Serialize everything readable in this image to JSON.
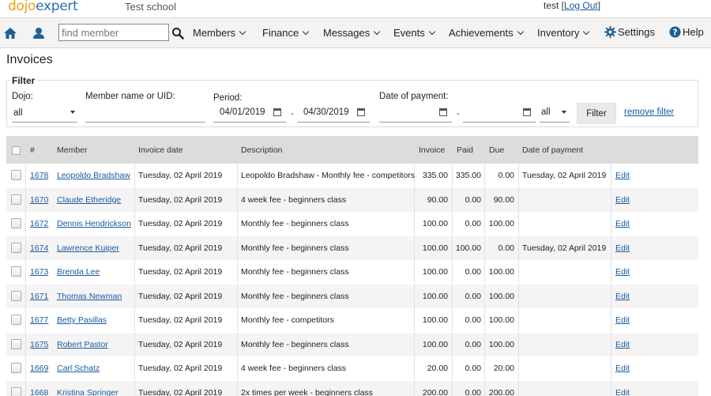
{
  "brand": {
    "logo_part1": "dojo",
    "logo_part2": "expert",
    "school": "Test school"
  },
  "user": {
    "name": "test",
    "logout_label": "Log Out"
  },
  "nav": {
    "search_placeholder": "find member",
    "items": [
      {
        "label": "Members"
      },
      {
        "label": "Finance"
      },
      {
        "label": "Messages"
      },
      {
        "label": "Events"
      },
      {
        "label": "Achievements"
      },
      {
        "label": "Inventory"
      },
      {
        "label": "Settings"
      },
      {
        "label": "Help"
      }
    ]
  },
  "page": {
    "title": "Invoices"
  },
  "filter": {
    "legend": "Filter",
    "dojo_label": "Dojo:",
    "dojo_value": "all",
    "member_label": "Member name or UID:",
    "member_value": "",
    "period_label": "Period:",
    "period_from": "04/01/2019",
    "period_to": "04/30/2019",
    "period_separator": "-",
    "payment_label": "Date of payment:",
    "payment_from": "",
    "payment_to": "",
    "payment_separator": "-",
    "payment_scope": "all",
    "filter_button": "Filter",
    "remove_filter": "remove filter"
  },
  "table": {
    "columns": [
      "#",
      "Member",
      "Invoice date",
      "Description",
      "Invoice",
      "Paid",
      "Due",
      "Date of payment"
    ],
    "rows": [
      {
        "id": "1678",
        "member": "Leopoldo Bradshaw",
        "date": "Tuesday, 02 April 2019",
        "description": "Leopoldo Bradshaw - Monthly fee - competitors",
        "invoice": "335.00",
        "paid": "335.00",
        "due": "0.00",
        "payment_date": "Tuesday, 02 April 2019",
        "action": "Edit"
      },
      {
        "id": "1670",
        "member": "Claude Etheridge",
        "date": "Tuesday, 02 April 2019",
        "description": "4 week fee - beginners class",
        "invoice": "90.00",
        "paid": "0.00",
        "due": "90.00",
        "payment_date": "",
        "action": "Edit"
      },
      {
        "id": "1672",
        "member": "Dennis Hendrickson",
        "date": "Tuesday, 02 April 2019",
        "description": "Monthly fee - beginners class",
        "invoice": "100.00",
        "paid": "0.00",
        "due": "100.00",
        "payment_date": "",
        "action": "Edit"
      },
      {
        "id": "1674",
        "member": "Lawrence Kuiper",
        "date": "Tuesday, 02 April 2019",
        "description": "Monthly fee - beginners class",
        "invoice": "100.00",
        "paid": "100.00",
        "due": "0.00",
        "payment_date": "Tuesday, 02 April 2019",
        "action": "Edit"
      },
      {
        "id": "1673",
        "member": "Brenda Lee",
        "date": "Tuesday, 02 April 2019",
        "description": "Monthly fee - beginners class",
        "invoice": "100.00",
        "paid": "0.00",
        "due": "100.00",
        "payment_date": "",
        "action": "Edit"
      },
      {
        "id": "1671",
        "member": "Thomas Newman",
        "date": "Tuesday, 02 April 2019",
        "description": "Monthly fee - beginners class",
        "invoice": "100.00",
        "paid": "0.00",
        "due": "100.00",
        "payment_date": "",
        "action": "Edit"
      },
      {
        "id": "1677",
        "member": "Betty Pasillas",
        "date": "Tuesday, 02 April 2019",
        "description": "Monthly fee - competitors",
        "invoice": "100.00",
        "paid": "0.00",
        "due": "100.00",
        "payment_date": "",
        "action": "Edit"
      },
      {
        "id": "1675",
        "member": "Robert Pastor",
        "date": "Tuesday, 02 April 2019",
        "description": "Monthly fee - beginners class",
        "invoice": "100.00",
        "paid": "0.00",
        "due": "100.00",
        "payment_date": "",
        "action": "Edit"
      },
      {
        "id": "1669",
        "member": "Carl Schatz",
        "date": "Tuesday, 02 April 2019",
        "description": "4 week fee - beginners class",
        "invoice": "20.00",
        "paid": "0.00",
        "due": "20.00",
        "payment_date": "",
        "action": "Edit"
      },
      {
        "id": "1668",
        "member": "Kristina Springer",
        "date": "Tuesday, 02 April 2019",
        "description": "2x times per week - beginners class",
        "invoice": "200.00",
        "paid": "0.00",
        "due": "200.00",
        "payment_date": "",
        "action": "Edit"
      }
    ]
  },
  "colors": {
    "link": "#1a5aa0",
    "logo_orange": "#e8a21a",
    "logo_blue": "#2a6fb0",
    "header_bg": "#dcdcdc"
  }
}
